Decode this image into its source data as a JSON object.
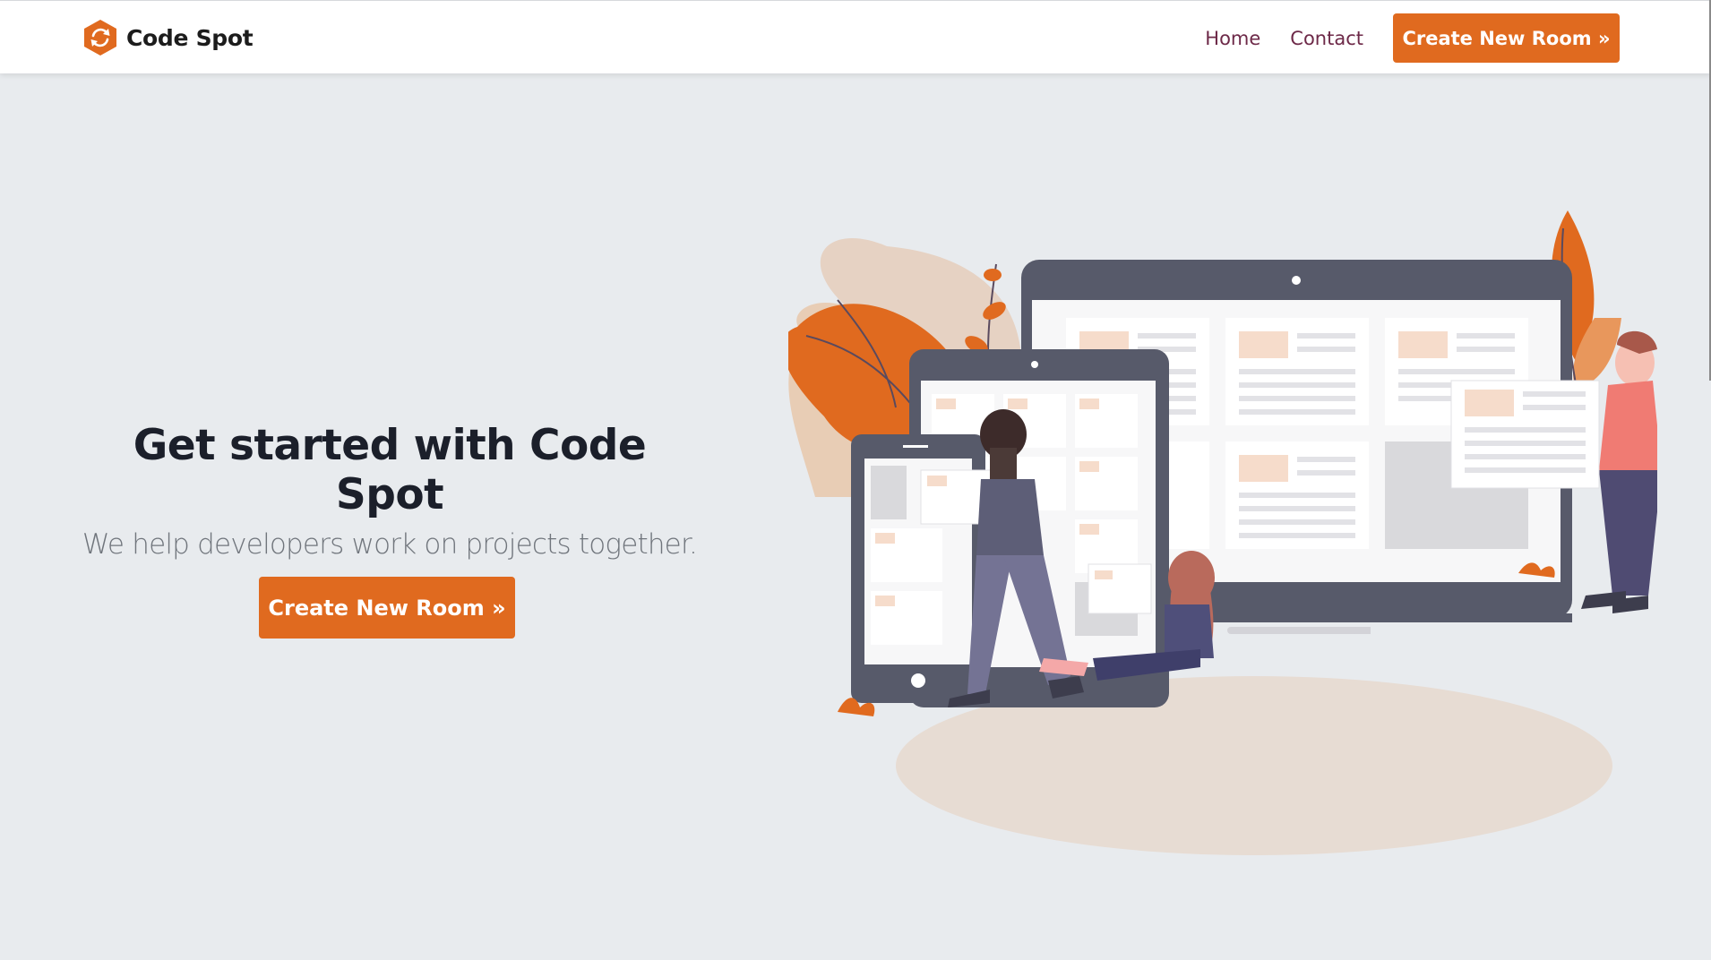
{
  "brand": {
    "name": "Code Spot",
    "logo_icon": "refresh-hexagon-icon",
    "accent_color": "#e06a1f"
  },
  "nav": {
    "links": [
      {
        "label": "Home"
      },
      {
        "label": "Contact"
      }
    ],
    "cta_label": "Create New Room »"
  },
  "hero": {
    "title": "Get started with Code Spot",
    "subtitle": "We help developers work on projects together.",
    "cta_label": "Create New Room »",
    "illustration": "people-collaborating-on-devices-illustration"
  },
  "colors": {
    "page_background": "#e8ebee",
    "title_text": "#1b1f2a",
    "subtitle_text": "#70757c",
    "nav_link": "#6d2948",
    "button": "#e06a1f"
  }
}
